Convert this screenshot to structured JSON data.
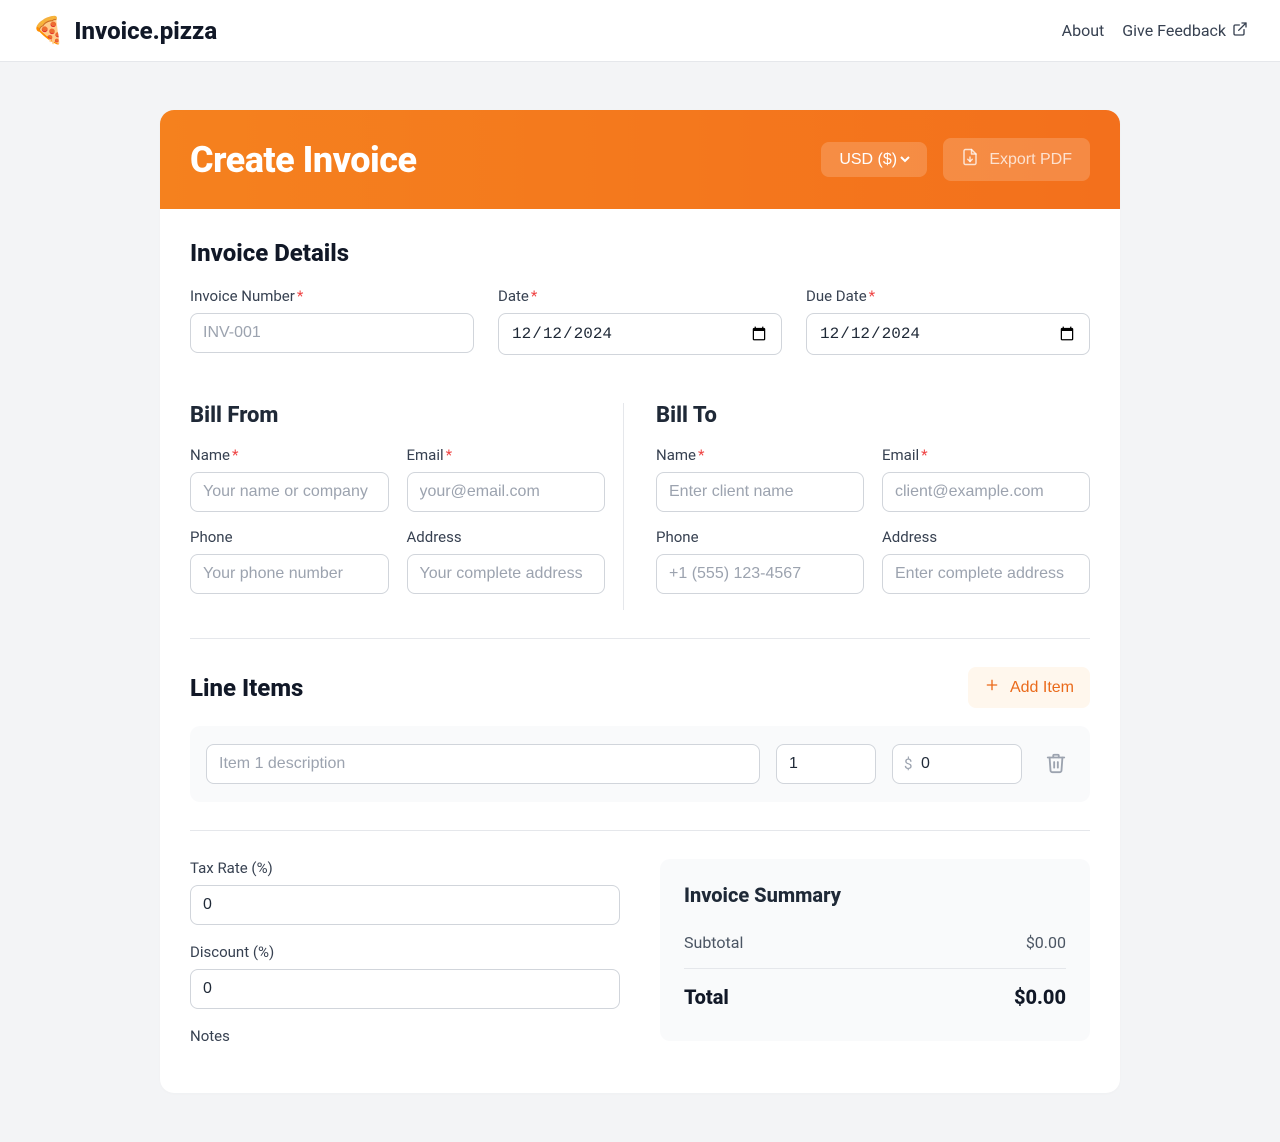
{
  "topbar": {
    "brand_emoji": "🍕",
    "brand_name": "Invoice.pizza",
    "nav_about": "About",
    "nav_feedback": "Give Feedback"
  },
  "header": {
    "title": "Create Invoice",
    "currency_selected": "USD ($)",
    "export_label": "Export PDF"
  },
  "details": {
    "section_title": "Invoice Details",
    "invoice_number_label": "Invoice Number",
    "invoice_number_placeholder": "INV-001",
    "date_label": "Date",
    "date_value": "2024-12-12",
    "due_date_label": "Due Date",
    "due_date_value": "2024-12-12"
  },
  "bill_from": {
    "title": "Bill From",
    "name_label": "Name",
    "name_placeholder": "Your name or company",
    "email_label": "Email",
    "email_placeholder": "your@email.com",
    "phone_label": "Phone",
    "phone_placeholder": "Your phone number",
    "address_label": "Address",
    "address_placeholder": "Your complete address"
  },
  "bill_to": {
    "title": "Bill To",
    "name_label": "Name",
    "name_placeholder": "Enter client name",
    "email_label": "Email",
    "email_placeholder": "client@example.com",
    "phone_label": "Phone",
    "phone_placeholder": "+1 (555) 123-4567",
    "address_label": "Address",
    "address_placeholder": "Enter complete address"
  },
  "line_items": {
    "title": "Line Items",
    "add_label": "Add Item",
    "rows": [
      {
        "desc_placeholder": "Item 1 description",
        "qty": "1",
        "price": "0",
        "currency_symbol": "$"
      }
    ]
  },
  "adjustments": {
    "tax_label": "Tax Rate (%)",
    "tax_value": "0",
    "discount_label": "Discount (%)",
    "discount_value": "0",
    "notes_label": "Notes"
  },
  "summary": {
    "title": "Invoice Summary",
    "subtotal_label": "Subtotal",
    "subtotal_value": "$0.00",
    "total_label": "Total",
    "total_value": "$0.00"
  }
}
